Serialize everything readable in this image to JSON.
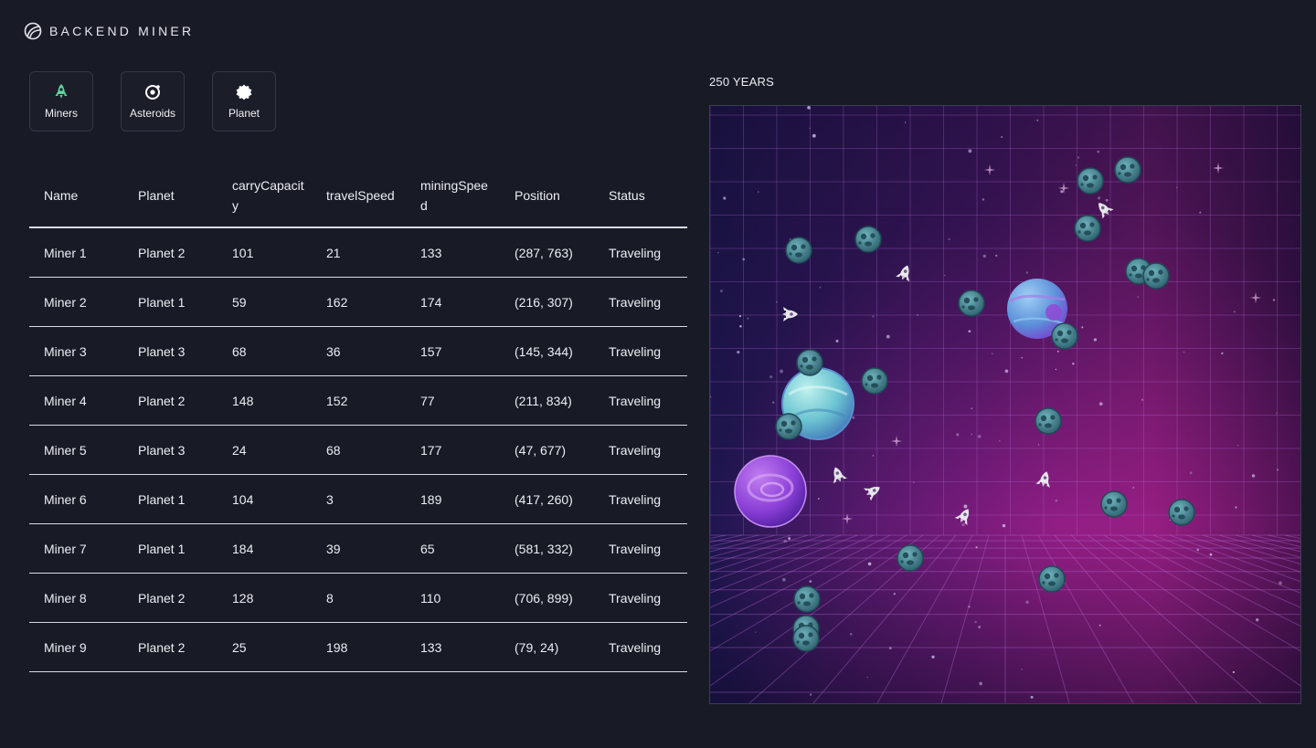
{
  "app": {
    "title": "BACKEND MINER",
    "logo_icon": "leaf-swirl-logo"
  },
  "tabs": [
    {
      "label": "Miners",
      "icon": "rocket-icon",
      "icon_color": "#5fd39b"
    },
    {
      "label": "Asteroids",
      "icon": "asteroid-icon",
      "icon_color": "#ffffff"
    },
    {
      "label": "Planet",
      "icon": "planet-icon",
      "icon_color": "#ffffff"
    }
  ],
  "table": {
    "columns": [
      "Name",
      "Planet",
      "carryCapacity",
      "travelSpeed",
      "miningSpeed",
      "Position",
      "Status"
    ],
    "rows": [
      [
        "Miner 1",
        "Planet 2",
        "101",
        "21",
        "133",
        "(287, 763)",
        "Traveling"
      ],
      [
        "Miner 2",
        "Planet 1",
        "59",
        "162",
        "174",
        "(216, 307)",
        "Traveling"
      ],
      [
        "Miner 3",
        "Planet 3",
        "68",
        "36",
        "157",
        "(145, 344)",
        "Traveling"
      ],
      [
        "Miner 4",
        "Planet 2",
        "148",
        "152",
        "77",
        "(211, 834)",
        "Traveling"
      ],
      [
        "Miner 5",
        "Planet 3",
        "24",
        "68",
        "177",
        "(47, 677)",
        "Traveling"
      ],
      [
        "Miner 6",
        "Planet 1",
        "104",
        "3",
        "189",
        "(417, 260)",
        "Traveling"
      ],
      [
        "Miner 7",
        "Planet 1",
        "184",
        "39",
        "65",
        "(581, 332)",
        "Traveling"
      ],
      [
        "Miner 8",
        "Planet 2",
        "128",
        "8",
        "110",
        "(706, 899)",
        "Traveling"
      ],
      [
        "Miner 9",
        "Planet 2",
        "25",
        "198",
        "133",
        "(79, 24)",
        "Traveling"
      ]
    ]
  },
  "simulation": {
    "elapsed_label": "250 YEARS"
  },
  "colors": {
    "background": "#181a26",
    "asteroid": "#3f8591",
    "planet_blue": "#6aa8dd",
    "planet_cyan": "#7fd2d6",
    "planet_purple": "#8a3fd6",
    "scene_magenta": "#8c1a7e"
  }
}
